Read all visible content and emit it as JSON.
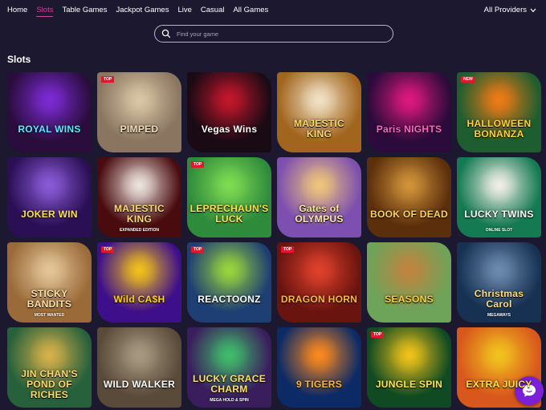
{
  "nav": {
    "items": [
      {
        "label": "Home",
        "active": false
      },
      {
        "label": "Slots",
        "active": true
      },
      {
        "label": "Table Games",
        "active": false
      },
      {
        "label": "Jackpot Games",
        "active": false
      },
      {
        "label": "Live",
        "active": false
      },
      {
        "label": "Casual",
        "active": false
      },
      {
        "label": "All Games",
        "active": false
      }
    ],
    "providers_label": "All Providers",
    "active_color": "#d43ea0"
  },
  "search": {
    "placeholder": "Find your game",
    "value": ""
  },
  "section": {
    "title": "Slots"
  },
  "games": [
    {
      "title": "ROYAL WINS",
      "subtitle": "",
      "badge": "",
      "bg": "#2a0d3d",
      "accent": "#7d2bd6",
      "text_color": "#5fe8ff"
    },
    {
      "title": "PIMPED",
      "subtitle": "",
      "badge": "TOP",
      "bg": "#8a7560",
      "accent": "#d9c7a6",
      "text_color": "#f3dfb5"
    },
    {
      "title": "Vegas Wins",
      "subtitle": "",
      "badge": "",
      "bg": "#1a0a14",
      "accent": "#c5162c",
      "text_color": "#ffffff"
    },
    {
      "title": "MAJESTIC KING",
      "subtitle": "",
      "badge": "",
      "bg": "#a2651e",
      "accent": "#f2e3c7",
      "text_color": "#ffd86b"
    },
    {
      "title": "Paris NIGHTS",
      "subtitle": "",
      "badge": "",
      "bg": "#2b0b3b",
      "accent": "#e0187e",
      "text_color": "#ff64c8"
    },
    {
      "title": "HALLOWEEN BONANZA",
      "subtitle": "",
      "badge": "NEW",
      "bg": "#1d5d2f",
      "accent": "#f27a14",
      "text_color": "#ffd23a"
    },
    {
      "title": "JOKER WIN",
      "subtitle": "",
      "badge": "",
      "bg": "#2a0f55",
      "accent": "#8b5bd8",
      "text_color": "#ffe14a"
    },
    {
      "title": "MAJESTIC KING",
      "subtitle": "EXPANDED EDITION",
      "badge": "",
      "bg": "#4a0b0f",
      "accent": "#eee5df",
      "text_color": "#ffd86b"
    },
    {
      "title": "LEPRECHAUN'S LUCK",
      "subtitle": "",
      "badge": "TOP",
      "bg": "#2f8b3c",
      "accent": "#7fdc51",
      "text_color": "#ffe34d"
    },
    {
      "title": "Gates of OLYMPUS",
      "subtitle": "",
      "badge": "",
      "bg": "#7d4fb0",
      "accent": "#f0c67a",
      "text_color": "#ffe9a8"
    },
    {
      "title": "BOOK OF DEAD",
      "subtitle": "",
      "badge": "",
      "bg": "#5b2e0c",
      "accent": "#d19439",
      "text_color": "#ffd262"
    },
    {
      "title": "LUCKY TWINS",
      "subtitle": "ONLINE SLOT",
      "badge": "",
      "bg": "#147a52",
      "accent": "#f3efe8",
      "text_color": "#ffffff"
    },
    {
      "title": "STICKY BANDITS",
      "subtitle": "MOST WANTED",
      "badge": "",
      "bg": "#9b6a39",
      "accent": "#e3c79a",
      "text_color": "#ffe2a4"
    },
    {
      "title": "Wild CA$H",
      "subtitle": "",
      "badge": "TOP",
      "bg": "#3e0f8a",
      "accent": "#f3c21a",
      "text_color": "#ffd31a"
    },
    {
      "title": "REACTOONZ",
      "subtitle": "",
      "badge": "TOP",
      "bg": "#1e3f73",
      "accent": "#9bd63b",
      "text_color": "#ffffff"
    },
    {
      "title": "DRAGON HORN",
      "subtitle": "",
      "badge": "TOP",
      "bg": "#6a1410",
      "accent": "#e0412b",
      "text_color": "#ffb83a"
    },
    {
      "title": "SEASONS",
      "subtitle": "",
      "badge": "",
      "bg": "#6ea35a",
      "accent": "#c1843f",
      "text_color": "#ffcf3a"
    },
    {
      "title": "Christmas Carol",
      "subtitle": "MEGAWAYS",
      "badge": "",
      "bg": "#163152",
      "accent": "#6d8bb0",
      "text_color": "#ffde7d"
    },
    {
      "title": "JIN CHAN'S POND OF RICHES",
      "subtitle": "",
      "badge": "",
      "bg": "#27613b",
      "accent": "#d8b14a",
      "text_color": "#ffd86b"
    },
    {
      "title": "WILD WALKER",
      "subtitle": "",
      "badge": "",
      "bg": "#5a4a3a",
      "accent": "#a89a82",
      "text_color": "#ffffff"
    },
    {
      "title": "LUCKY GRACE CHARM",
      "subtitle": "MEGA HOLD & SPIN",
      "badge": "",
      "bg": "#3a1d5c",
      "accent": "#3fbf6b",
      "text_color": "#ffe066"
    },
    {
      "title": "9 TIGERS",
      "subtitle": "",
      "badge": "",
      "bg": "#0c2a66",
      "accent": "#ff8a1c",
      "text_color": "#ffb43a"
    },
    {
      "title": "JUNGLE SPIN",
      "subtitle": "",
      "badge": "TOP",
      "bg": "#0f4a22",
      "accent": "#f2c31a",
      "text_color": "#ffe34d"
    },
    {
      "title": "EXTRA JUICY",
      "subtitle": "",
      "badge": "",
      "bg": "#d8571c",
      "accent": "#f2c41e",
      "text_color": "#ffe54a"
    }
  ],
  "chat": {
    "icon": "chat-bubble-icon",
    "color": "#7b1fd8"
  }
}
